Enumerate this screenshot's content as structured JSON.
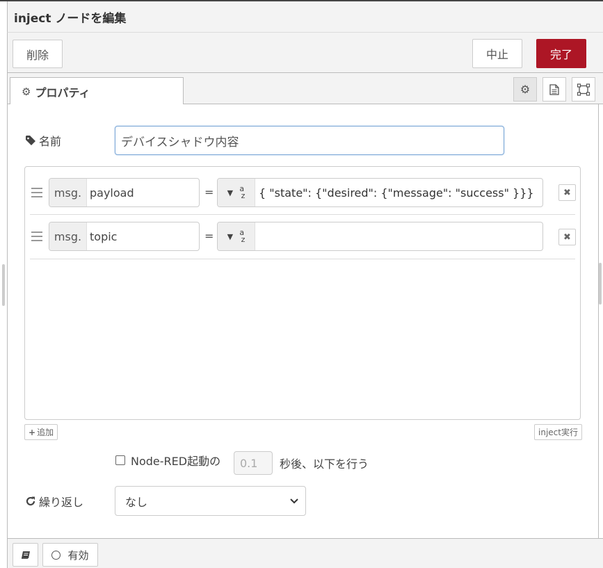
{
  "dialog": {
    "title": "inject ノードを編集"
  },
  "tray": {
    "delete_label": "削除",
    "cancel_label": "中止",
    "done_label": "完了"
  },
  "tabs": {
    "properties_label": "プロパティ"
  },
  "form": {
    "name_label": "名前",
    "name_value": "デバイスシャドウ内容",
    "properties": [
      {
        "prefix": "msg.",
        "key": "payload",
        "equals": "=",
        "type": "az",
        "value": "{ \"state\": {\"desired\": {\"message\": \"success\" }}}"
      },
      {
        "prefix": "msg.",
        "key": "topic",
        "equals": "=",
        "type": "az",
        "value": ""
      }
    ],
    "add_label": "追加",
    "inject_label": "inject実行",
    "startup_label": "Node-RED起動の",
    "startup_delay_value": "0.1",
    "startup_after_label": "秒後、以下を行う",
    "repeat_label": "繰り返し",
    "repeat_value": "なし"
  },
  "footer": {
    "enabled_label": "有効"
  },
  "colors": {
    "done_button": "#ad1625",
    "focus_border": "#7aa6d6"
  },
  "icons": {
    "properties_tab": "gear-icon",
    "description_tab": "document-icon",
    "appearance_tab": "frame-icon",
    "name_label": "tag-icon",
    "repeat_label": "refresh-icon",
    "footer_left": "book-icon"
  }
}
